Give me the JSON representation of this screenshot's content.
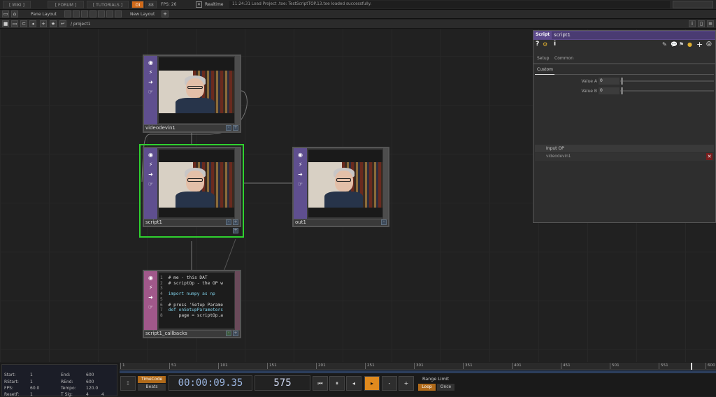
{
  "topbar": {
    "wiki": "[ WIKI ]",
    "forum": "[ FORUM ]",
    "tutorials": "[ TUTORIALS ]",
    "oi": "OI",
    "fps_label": "FPS:",
    "fps_value": "26",
    "realtime": "Realtime",
    "status_message": "11:24:31 Load Project .toe: TestScriptTOP.13.toe loaded successfully."
  },
  "layoutbar": {
    "pane_layout": "Pane Layout",
    "new_layout": "New Layout"
  },
  "pathbar": {
    "path": "/ project1"
  },
  "nodes": {
    "videodevin": "videodevin1",
    "script": "script1",
    "out": "out1",
    "callbacks": "script1_callbacks"
  },
  "code_lines": [
    {
      "n": "1",
      "t": "# me - this DAT"
    },
    {
      "n": "2",
      "t": "# scriptOp - the OP w"
    },
    {
      "n": "3",
      "t": ""
    },
    {
      "n": "4",
      "t": "import numpy as np"
    },
    {
      "n": "5",
      "t": ""
    },
    {
      "n": "6",
      "t": "# press 'Setup Parame"
    },
    {
      "n": "7",
      "t": "def onSetupParameters"
    },
    {
      "n": "8",
      "t": "    page = scriptOp.a"
    }
  ],
  "panel": {
    "type": "Script",
    "name": "script1",
    "tab_setup": "Setup",
    "tab_common": "Common",
    "tab_custom": "Custom",
    "value_a_label": "Value A",
    "value_a": "0",
    "value_b_label": "Value B",
    "value_b": "0",
    "input_header": "Input OP",
    "input_value": "videodevin1"
  },
  "stats": {
    "start_label": "Start:",
    "start": "1",
    "rstart_label": "RStart:",
    "rstart": "1",
    "fps_label": "FPS:",
    "fps": "60.0",
    "resetf_label": "ResetF:",
    "resetf": "1",
    "end_label": "End:",
    "end": "600",
    "rend_label": "REnd:",
    "rend": "600",
    "tempo_label": "Tempo:",
    "tempo": "120.0",
    "tsig_label": "T Sig:",
    "tsig_a": "4",
    "tsig_b": "4"
  },
  "ruler": [
    "1",
    "51",
    "101",
    "151",
    "201",
    "251",
    "301",
    "351",
    "401",
    "451",
    "501",
    "551",
    "600"
  ],
  "transport": {
    "timecode_btn": "TimeCode",
    "beats_btn": "Beats",
    "timecode": "00:00:09.35",
    "frame": "575",
    "range_limit": "Range Limit",
    "loop": "Loop",
    "once": "Once",
    "rewind": "⏮",
    "pause": "⏸",
    "step_back": "◂",
    "play": "▸",
    "minus": "-",
    "plus": "+"
  },
  "colors": {
    "selected": "#2fd12f",
    "top_family": "#5f4f8f",
    "dat_family": "#a0588a",
    "panel_header": "#5d4a8c",
    "accent": "#e08a1e"
  }
}
